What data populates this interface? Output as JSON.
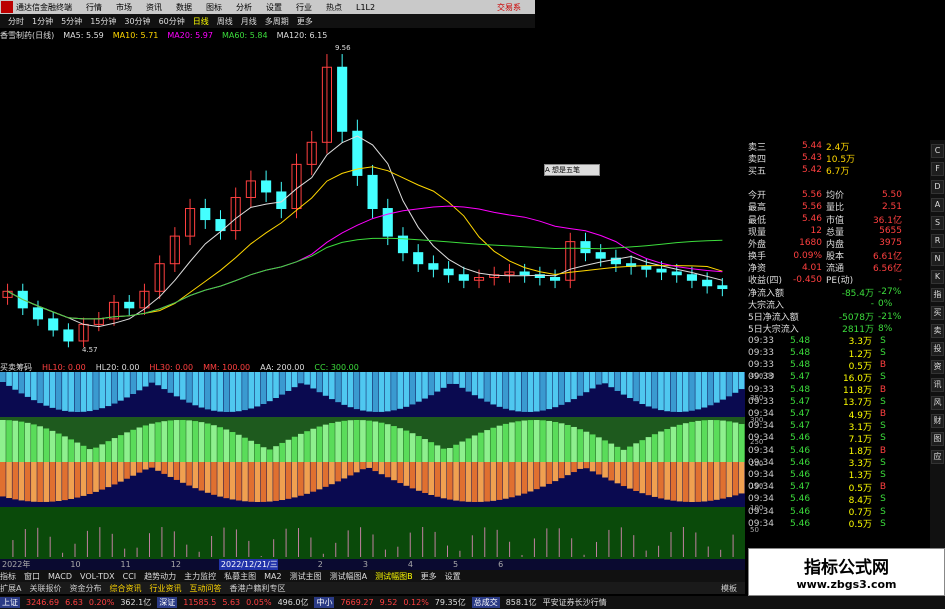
{
  "title_bar": {
    "app_title": "通达信金融终端",
    "menus": [
      "行情",
      "市场",
      "资讯",
      "数据",
      "图标",
      "分析",
      "设置",
      "行业",
      "热点",
      "L1L2"
    ],
    "trade": "交易系"
  },
  "period_bar": {
    "items": [
      "分时",
      "1分钟",
      "5分钟",
      "15分钟",
      "30分钟",
      "60分钟",
      "日线",
      "周线",
      "月线",
      "多周期",
      "更多"
    ],
    "active": "日线"
  },
  "ma_bar": {
    "stock": "香雪制药(日线)",
    "ma5": "MA5: 5.59",
    "ma10": "MA10: 5.71",
    "ma20": "MA20: 5.97",
    "ma60": "MA60: 5.84",
    "ma120": "MA120: 6.15"
  },
  "main_chart": {
    "high_label": "9.56",
    "low_label": "4.57",
    "y_ticks": [
      "7.50",
      "7.00",
      "6.50",
      "6.00",
      "5.50",
      "5.00"
    ],
    "closes": [
      5.5,
      5.2,
      5.0,
      4.8,
      4.6,
      4.9,
      5.0,
      5.3,
      5.2,
      5.5,
      6.0,
      6.5,
      7.0,
      6.8,
      6.6,
      7.2,
      7.5,
      7.3,
      7.0,
      7.8,
      8.2,
      9.56,
      8.4,
      7.6,
      7.0,
      6.5,
      6.2,
      6.0,
      5.9,
      5.8,
      5.7,
      5.75,
      5.8,
      5.85,
      5.8,
      5.75,
      5.7,
      6.4,
      6.2,
      6.1,
      6.0,
      5.95,
      5.9,
      5.85,
      5.8,
      5.7,
      5.6,
      5.55
    ]
  },
  "indicator": {
    "name": "买卖筹码",
    "hl10": "HL10: 0.00",
    "hl20": "HL20: 0.00",
    "hl30": "HL30: 0.00",
    "mm": "MM: 100.00",
    "aa": "AA: 200.00",
    "cc": "CC: 300.00",
    "y_ticks": [
      "400.00",
      "350",
      "300",
      "250",
      "200",
      "150",
      "100",
      "50"
    ]
  },
  "date_bar": {
    "labels": [
      "2022年",
      "10",
      "11",
      "12",
      "2022/12/21/三",
      "2",
      "3",
      "4",
      "5",
      "6"
    ],
    "selected": "2022/12/21/三"
  },
  "tab_bar": {
    "tabs": [
      "指标",
      "窗口",
      "MACD",
      "VOL-TDX",
      "CCI",
      "趋势动力",
      "主力监控",
      "私募主图",
      "MA2",
      "测试主图",
      "测试幅图A",
      "测试幅图B",
      "更多",
      "设置"
    ],
    "active": "测试幅图B"
  },
  "tool_bar": {
    "items": [
      "扩展A",
      "关联报价",
      "资金分布",
      "综合资讯",
      "行业资讯",
      "互动问答",
      "香港户籍利专区"
    ],
    "right": "模板"
  },
  "quote": {
    "asks": [
      {
        "label": "卖三",
        "price": "5.44",
        "vol": "2.4万"
      },
      {
        "label": "卖四",
        "price": "5.43",
        "vol": "10.5万"
      },
      {
        "label": "买五",
        "price": "5.42",
        "vol": "6.7万"
      }
    ],
    "stats": [
      [
        "今开",
        "5.56",
        "均价",
        "5.50"
      ],
      [
        "最高",
        "5.56",
        "量比",
        "2.51"
      ],
      [
        "最低",
        "5.46",
        "市值",
        "36.1亿"
      ],
      [
        "现量",
        "12",
        "总量",
        "5655"
      ],
      [
        "外盘",
        "1680",
        "内盘",
        "3975"
      ],
      [
        "换手",
        "0.09%",
        "股本",
        "6.61亿"
      ],
      [
        "净资",
        "4.01",
        "流通",
        "6.56亿"
      ],
      [
        "收益(四)",
        "-0.450",
        "PE(动)",
        "-"
      ]
    ],
    "flows": [
      [
        "净流入额",
        "-85.4万",
        "-27%"
      ],
      [
        "大宗流入",
        "-",
        "0%"
      ],
      [
        "5日净流入额",
        "-5078万",
        "-21%"
      ],
      [
        "5日大宗流入",
        "2811万",
        "8%"
      ]
    ],
    "ticks": [
      [
        "09:33",
        "5.48",
        "3.3万",
        "S"
      ],
      [
        "09:33",
        "5.48",
        "1.2万",
        "S"
      ],
      [
        "09:33",
        "5.48",
        "0.5万",
        "B"
      ],
      [
        "09:33",
        "5.47",
        "16.0万",
        "S"
      ],
      [
        "09:33",
        "5.48",
        "11.8万",
        "B"
      ],
      [
        "09:33",
        "5.47",
        "13.7万",
        "S"
      ],
      [
        "09:34",
        "5.47",
        "4.9万",
        "B"
      ],
      [
        "09:34",
        "5.47",
        "3.1万",
        "S"
      ],
      [
        "09:34",
        "5.46",
        "7.1万",
        "S"
      ],
      [
        "09:34",
        "5.46",
        "1.8万",
        "B"
      ],
      [
        "09:34",
        "5.46",
        "3.3万",
        "S"
      ],
      [
        "09:34",
        "5.46",
        "1.3万",
        "S"
      ],
      [
        "09:34",
        "5.47",
        "0.5万",
        "B"
      ],
      [
        "09:34",
        "5.46",
        "8.4万",
        "S"
      ],
      [
        "09:34",
        "5.46",
        "0.7万",
        "S"
      ],
      [
        "09:34",
        "5.46",
        "0.5万",
        "S"
      ]
    ]
  },
  "side_icons": [
    "C",
    "F",
    "D",
    "A",
    "S",
    "R",
    "N",
    "K",
    "指",
    "买",
    "卖",
    "投",
    "资",
    "讯",
    "风",
    "财",
    "图",
    "应"
  ],
  "popup": {
    "label": "A 想是五笔"
  },
  "watermark": {
    "title": "指标公式网",
    "url": "www.zbgs3.com"
  },
  "status_bar": [
    {
      "name": "上证",
      "val": "3246.69",
      "chg": "6.63",
      "pct": "0.20%",
      "amt": "362.1亿"
    },
    {
      "name": "深证",
      "val": "11585.5",
      "chg": "5.63",
      "pct": "0.05%",
      "amt": "496.0亿"
    },
    {
      "name": "中小",
      "val": "7669.27",
      "chg": "9.52",
      "pct": "0.12%",
      "amt": "79.35亿"
    }
  ],
  "status_extra": {
    "total_label": "总成交",
    "total": "858.1亿",
    "broker": "平安证券长沙行情"
  }
}
